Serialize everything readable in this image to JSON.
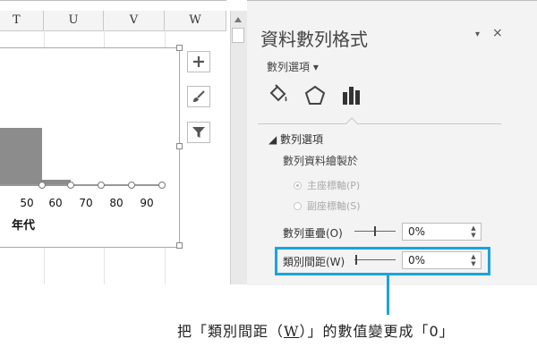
{
  "sheet": {
    "columns": [
      "T",
      "U",
      "V",
      "W"
    ],
    "axis_ticks": [
      "50",
      "60",
      "70",
      "80",
      "90"
    ],
    "axis_title": "年代"
  },
  "chart_tools": [
    "chart-elements-plus-icon",
    "chart-styles-brush-icon",
    "chart-filters-funnel-icon"
  ],
  "pane": {
    "title": "資料數列格式",
    "dropdown_icon": "▾",
    "close_icon": "×",
    "series_options_menu": "數列選項 ▾",
    "tabs": [
      "fill-line-icon",
      "effects-pentagon-icon",
      "series-options-bars-icon"
    ],
    "section_header": "◢ 數列選項",
    "plot_on_label": "數列資料繪製於",
    "radio_primary": "主座標軸(P)",
    "radio_secondary": "副座標軸(S)",
    "overlap_label": "數列重疊(O)",
    "overlap_value": "0%",
    "gap_label": "類別間距(W)",
    "gap_value": "0%"
  },
  "caption": {
    "before": "把「類別間距（",
    "underlined": "W",
    "after": "）」的數值變更成「0」"
  },
  "colors": {
    "highlight": "#1aa4dc",
    "bar_fill": "#8c8c8c"
  }
}
